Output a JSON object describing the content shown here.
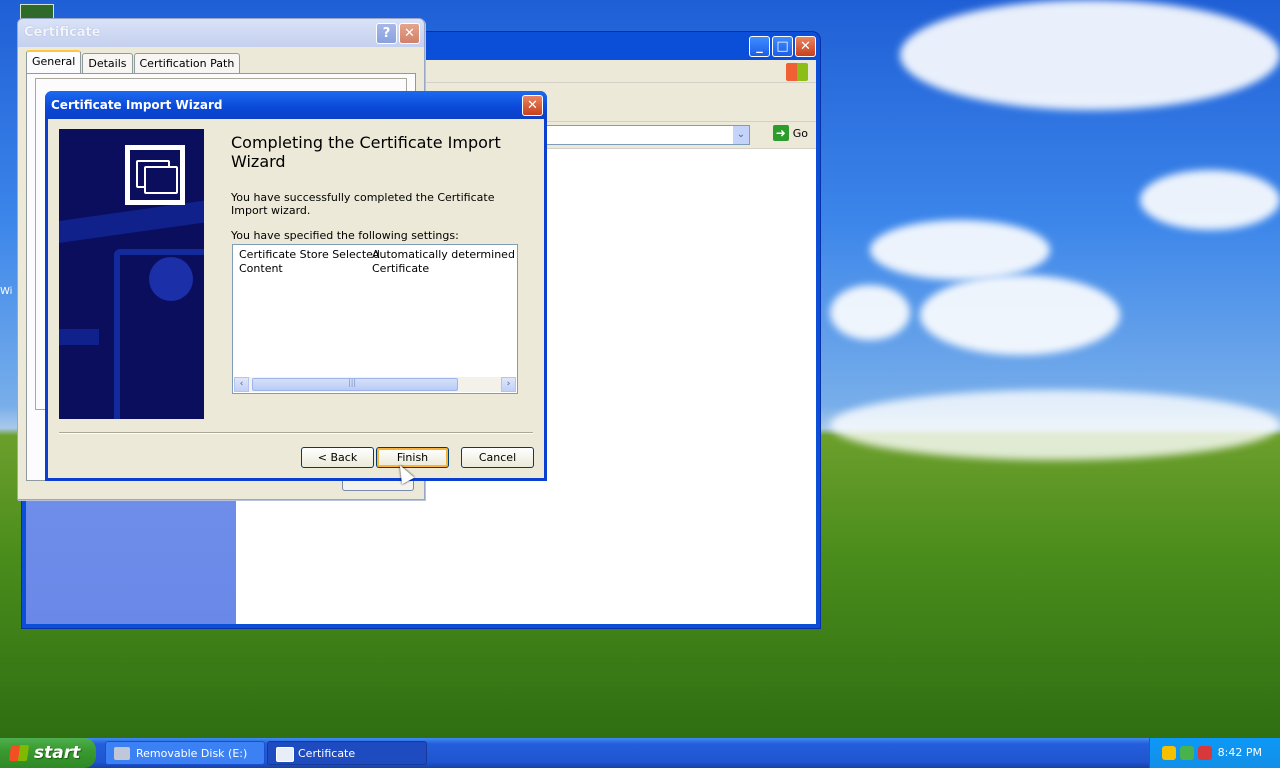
{
  "desktop": {
    "left_icon_fragment": "Wi"
  },
  "cert_dialog": {
    "title": "Certificate",
    "help_label": "?",
    "close_label": "✕",
    "tabs": [
      {
        "label": "General"
      },
      {
        "label": "Details"
      },
      {
        "label": "Certification Path"
      }
    ]
  },
  "explorer": {
    "minimize_label": "_",
    "maximize_label": "□",
    "close_label": "✕",
    "dropdown_label": "⌄",
    "go_icon": "➜",
    "go_label": "Go"
  },
  "wizard": {
    "title": "Certificate Import Wizard",
    "close_label": "✕",
    "heading": "Completing the Certificate Import Wizard",
    "success_text": "You have successfully completed the Certificate Import wizard.",
    "settings_label": "You have specified the following settings:",
    "settings": [
      {
        "name": "Certificate Store Selected",
        "value": "Automatically determined by t"
      },
      {
        "name": "Content",
        "value": "Certificate"
      }
    ],
    "scroll_left": "‹",
    "scroll_right": "›",
    "thumb_grip": "|||",
    "buttons": {
      "back": "< Back",
      "finish": "Finish",
      "cancel": "Cancel"
    }
  },
  "taskbar": {
    "start_label": "start",
    "items": [
      {
        "label": "Removable Disk (E:)"
      },
      {
        "label": "Certificate"
      }
    ],
    "clock": "8:42 PM"
  },
  "colors": {
    "xp_blue": "#0a48d8",
    "start_green": "#3a9a30",
    "dialog_bg": "#ece9d8",
    "banner": "#0a0e5c"
  }
}
